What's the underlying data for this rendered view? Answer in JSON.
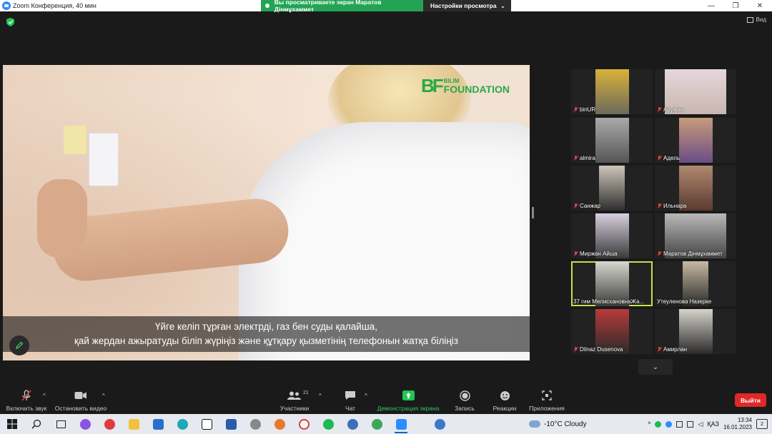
{
  "window": {
    "title": "Zoom Конференция, 40 мин",
    "controls": {
      "minimize": "—",
      "restore": "❐",
      "close": "✕"
    }
  },
  "share_banner": {
    "message": "Вы просматриваете экран Маратов Дінмұхаммет",
    "view_options": "Настройки просмотра",
    "caret": "⌄"
  },
  "top_right": {
    "view_label": "Вид"
  },
  "shared_screen": {
    "logo_mark": "BF",
    "logo_line1": "BILIM",
    "logo_line2": "FOUNDATION",
    "subtitle_line1": "Үйге келіп тұрған электрді, газ бен суды қалайша,",
    "subtitle_line2": "қай жердан ажыратуды біліп жүріңіз және құтқару қызметінің телефонын жатқа біліңіз"
  },
  "raise_hand_icon": "✋",
  "participants": [
    {
      "name": "binUR",
      "bg": "#6b6a5c",
      "face": "#d9b23a"
    },
    {
      "name": "Аружан",
      "bg": "#c9b6b0",
      "face": "#e6d6dc"
    },
    {
      "name": "almira",
      "bg": "#555",
      "face": "#a9a9a9"
    },
    {
      "name": "Адель",
      "bg": "#6a4d86",
      "face": "#c89b7a"
    },
    {
      "name": "Санжар",
      "bg": "#2e2e2e",
      "face": "#cfc6bb"
    },
    {
      "name": "Ильнара",
      "bg": "#5a3b30",
      "face": "#b08870"
    },
    {
      "name": "Миржан Айша",
      "bg": "#3a3a3a",
      "face": "#d8cfe0"
    },
    {
      "name": "Маратов Дінмұхаммет",
      "bg": "#444",
      "face": "#b9b9b9"
    },
    {
      "name": "37 гим МелисхановнаЖа...",
      "bg": "#3b3b3b",
      "face": "#d8d8d0"
    },
    {
      "name": "Утеуленова Назерке",
      "bg": "#2a2a2a",
      "face": "#c7b8a4"
    },
    {
      "name": "Dilnaz Dusenova",
      "bg": "#2a2a2a",
      "face": "#b83a3a"
    },
    {
      "name": "Амирлан",
      "bg": "#2a2a2a",
      "face": "#d6d2cb"
    }
  ],
  "gallery_nav": "⌄",
  "toolbar": {
    "audio": "Включить звук",
    "video": "Остановить видео",
    "participants": "Участники",
    "participants_count": "21",
    "chat": "Чат",
    "share": "Демонстрация экрана",
    "record": "Запись",
    "reactions": "Реакции",
    "apps": "Приложения",
    "leave": "Выйти",
    "caret": "^"
  },
  "taskbar": {
    "weather": "-10°C  Cloudy",
    "lang": "ҚАЗ",
    "time": "13:34",
    "date": "16.01.2023",
    "notifications": "2"
  },
  "colors": {
    "share_green": "#23a455",
    "leave_red": "#e02828",
    "active_speaker": "#c8e04a",
    "logo_green": "#2aa84a"
  }
}
